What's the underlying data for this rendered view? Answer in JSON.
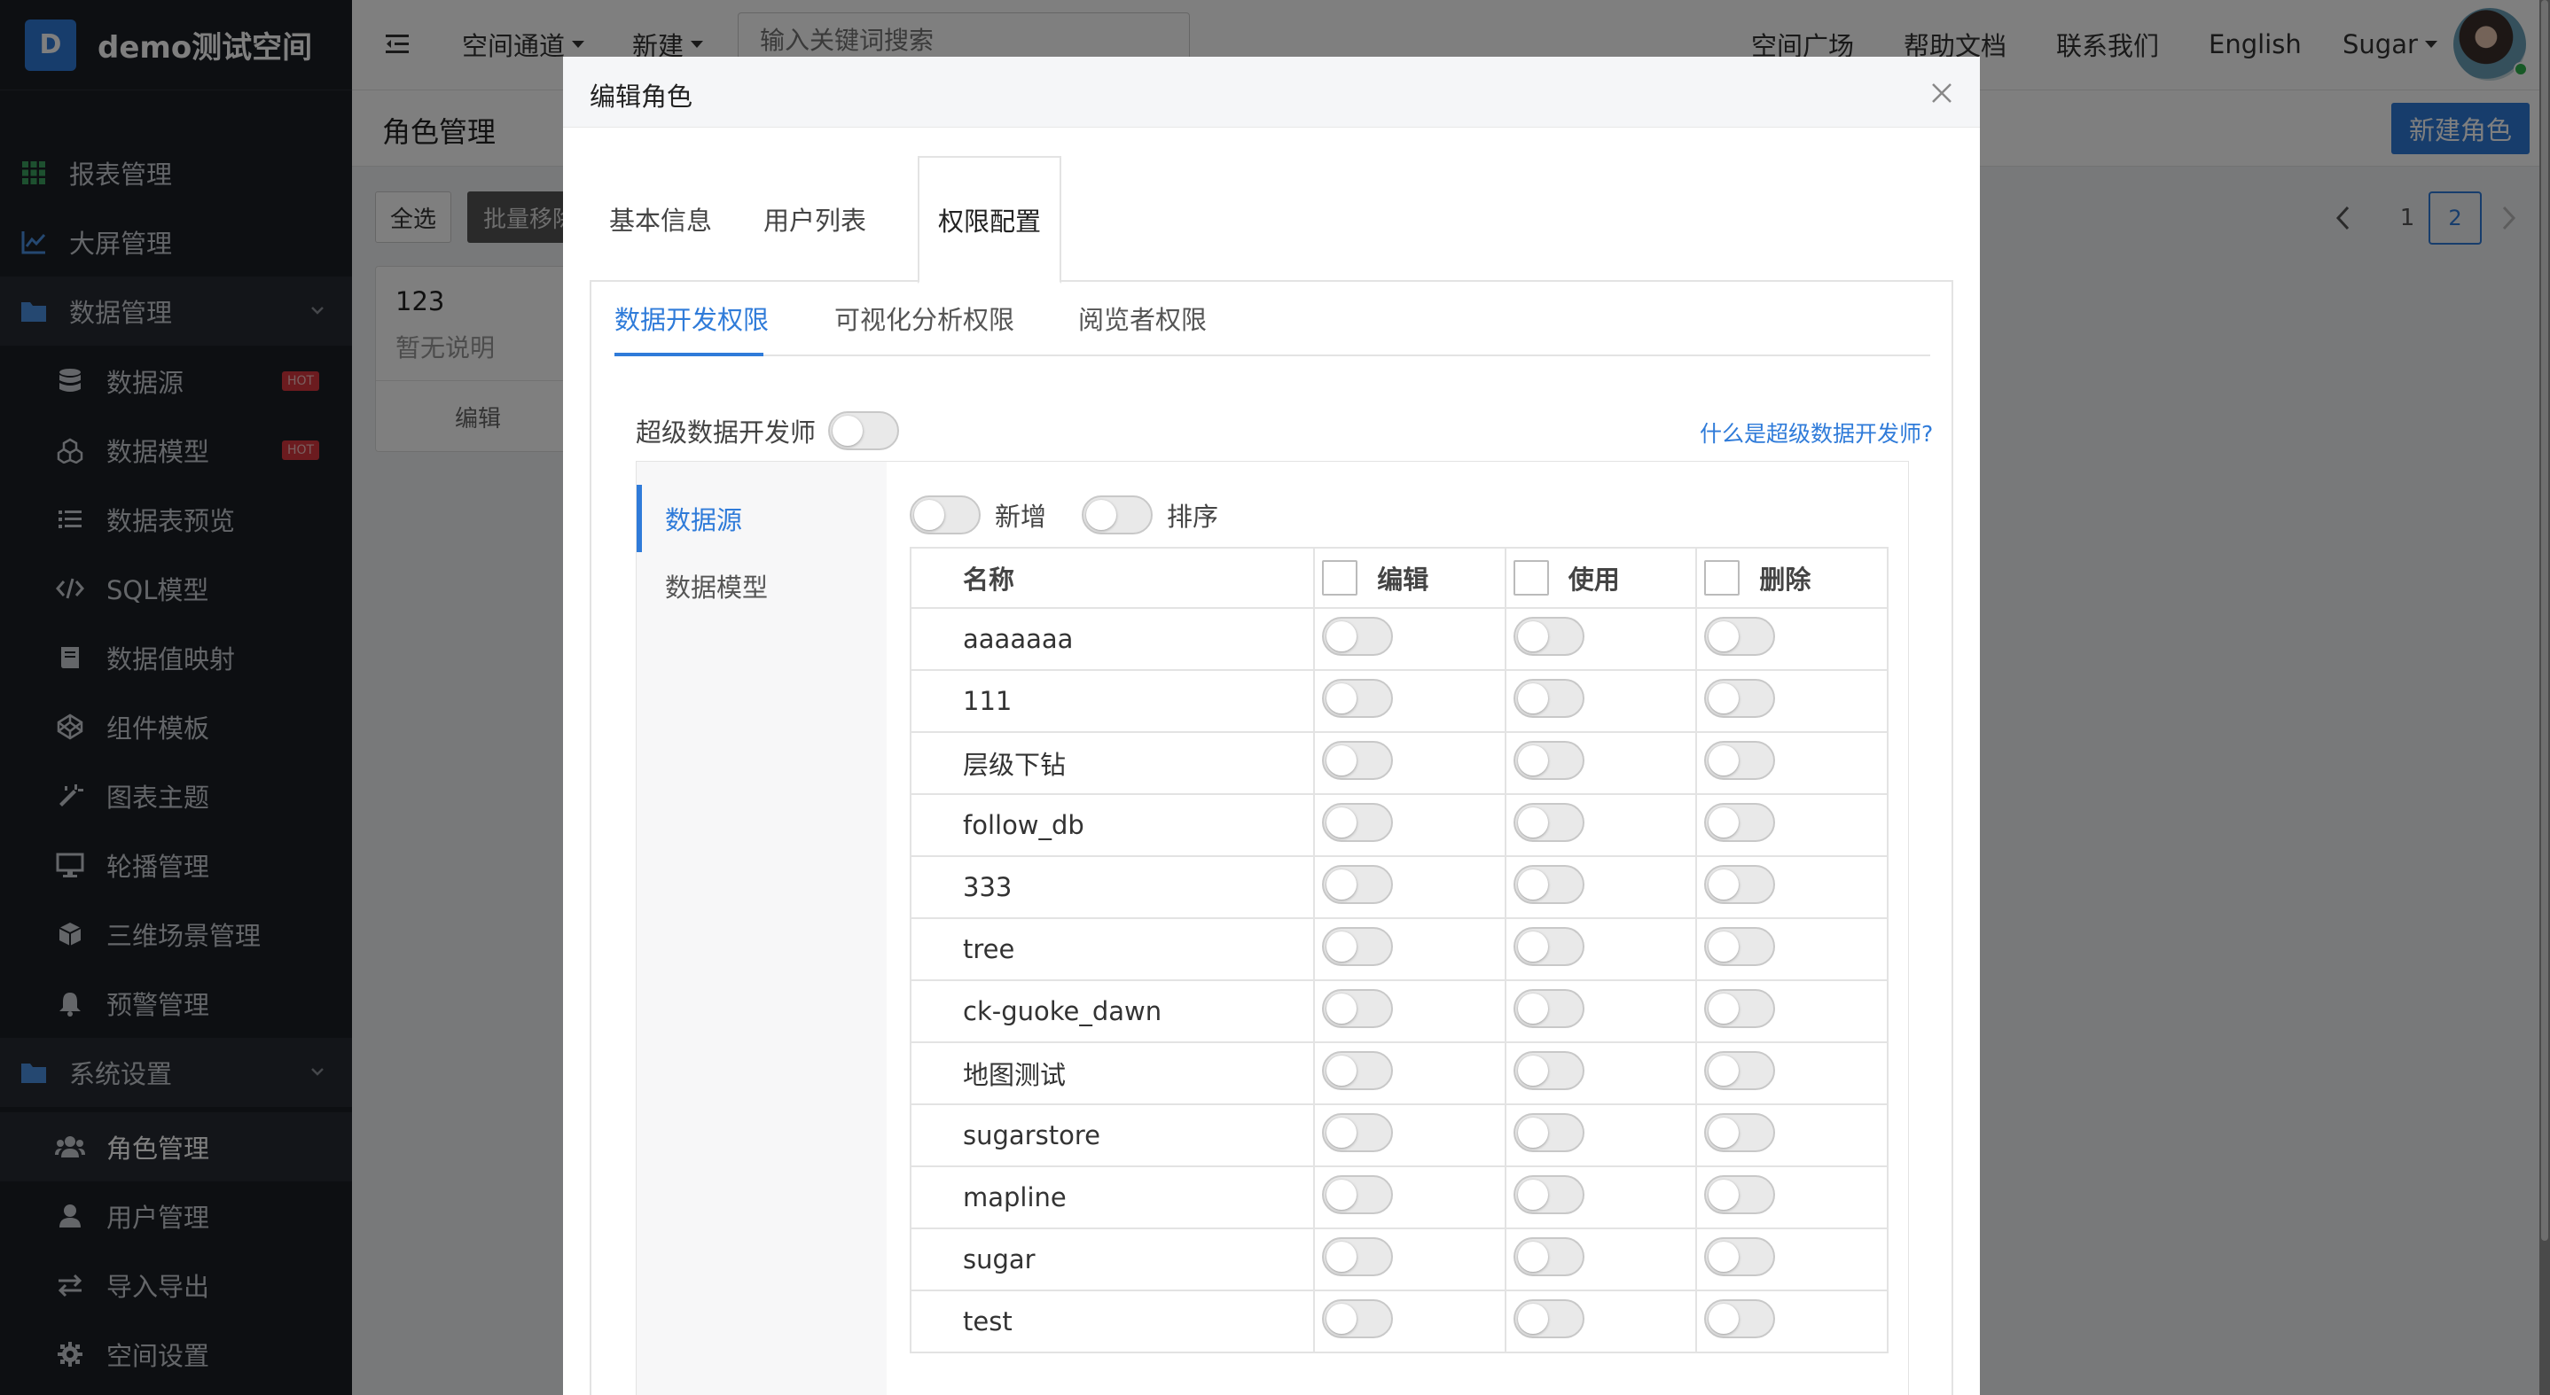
{
  "sidebar": {
    "brand_initial": "D",
    "brand_name": "demo测试空间",
    "items": [
      {
        "label": "报表管理",
        "icon": "grid-icon",
        "level": "top"
      },
      {
        "label": "大屏管理",
        "icon": "line-chart-icon",
        "level": "top"
      },
      {
        "label": "数据管理",
        "icon": "folder-icon",
        "level": "group"
      },
      {
        "label": "数据源",
        "icon": "database-icon",
        "level": "sub",
        "badge": "HOT"
      },
      {
        "label": "数据模型",
        "icon": "cubes-icon",
        "level": "sub",
        "badge": "HOT"
      },
      {
        "label": "数据表预览",
        "icon": "list-icon",
        "level": "sub"
      },
      {
        "label": "SQL模型",
        "icon": "code-icon",
        "level": "sub"
      },
      {
        "label": "数据值映射",
        "icon": "book-icon",
        "level": "sub"
      },
      {
        "label": "组件模板",
        "icon": "codepen-icon",
        "level": "sub"
      },
      {
        "label": "图表主题",
        "icon": "magic-wand-icon",
        "level": "sub"
      },
      {
        "label": "轮播管理",
        "icon": "monitor-icon",
        "level": "sub"
      },
      {
        "label": "三维场景管理",
        "icon": "cube-icon",
        "level": "sub"
      },
      {
        "label": "预警管理",
        "icon": "bell-icon",
        "level": "sub"
      },
      {
        "label": "系统设置",
        "icon": "folder-icon",
        "level": "group"
      },
      {
        "label": "角色管理",
        "icon": "users-icon",
        "level": "sub",
        "active": true
      },
      {
        "label": "用户管理",
        "icon": "user-icon",
        "level": "sub"
      },
      {
        "label": "导入导出",
        "icon": "exchange-icon",
        "level": "sub"
      },
      {
        "label": "空间设置",
        "icon": "gear-icon",
        "level": "sub"
      }
    ]
  },
  "header": {
    "space_channel": "空间通道",
    "new": "新建",
    "search_placeholder": "输入关键词搜索",
    "space_square": "空间广场",
    "help_docs": "帮助文档",
    "contact_us": "联系我们",
    "language": "English",
    "user": "Sugar"
  },
  "page": {
    "title": "角色管理",
    "new_role": "新建角色",
    "select_all": "全选",
    "batch_remove": "批量移除",
    "role_card": {
      "name": "123",
      "desc": "暂无说明",
      "edit": "编辑"
    },
    "pagination": {
      "pages": [
        "1",
        "2"
      ],
      "current": "2"
    }
  },
  "modal": {
    "title": "编辑角色",
    "tabs": [
      "基本信息",
      "用户列表",
      "权限配置"
    ],
    "active_tab": "权限配置",
    "sub_tabs": [
      "数据开发权限",
      "可视化分析权限",
      "阅览者权限"
    ],
    "active_sub_tab": "数据开发权限",
    "super_dev_label": "超级数据开发师",
    "super_dev_help": "什么是超级数据开发师?",
    "left_items": [
      "数据源",
      "数据模型"
    ],
    "active_left": "数据源",
    "toggle_add": "新增",
    "toggle_sort": "排序",
    "table": {
      "columns": [
        "名称",
        "编辑",
        "使用",
        "删除"
      ],
      "rows": [
        "aaaaaaa",
        "111",
        "层级下钻",
        "follow_db",
        "333",
        "tree",
        "ck-guoke_dawn",
        "地图测试",
        "sugarstore",
        "mapline",
        "sugar",
        "test"
      ]
    }
  },
  "colors": {
    "accent": "#2f7bd9",
    "sidebar_bg": "#1a1e24",
    "hot_badge": "#d9363e"
  }
}
